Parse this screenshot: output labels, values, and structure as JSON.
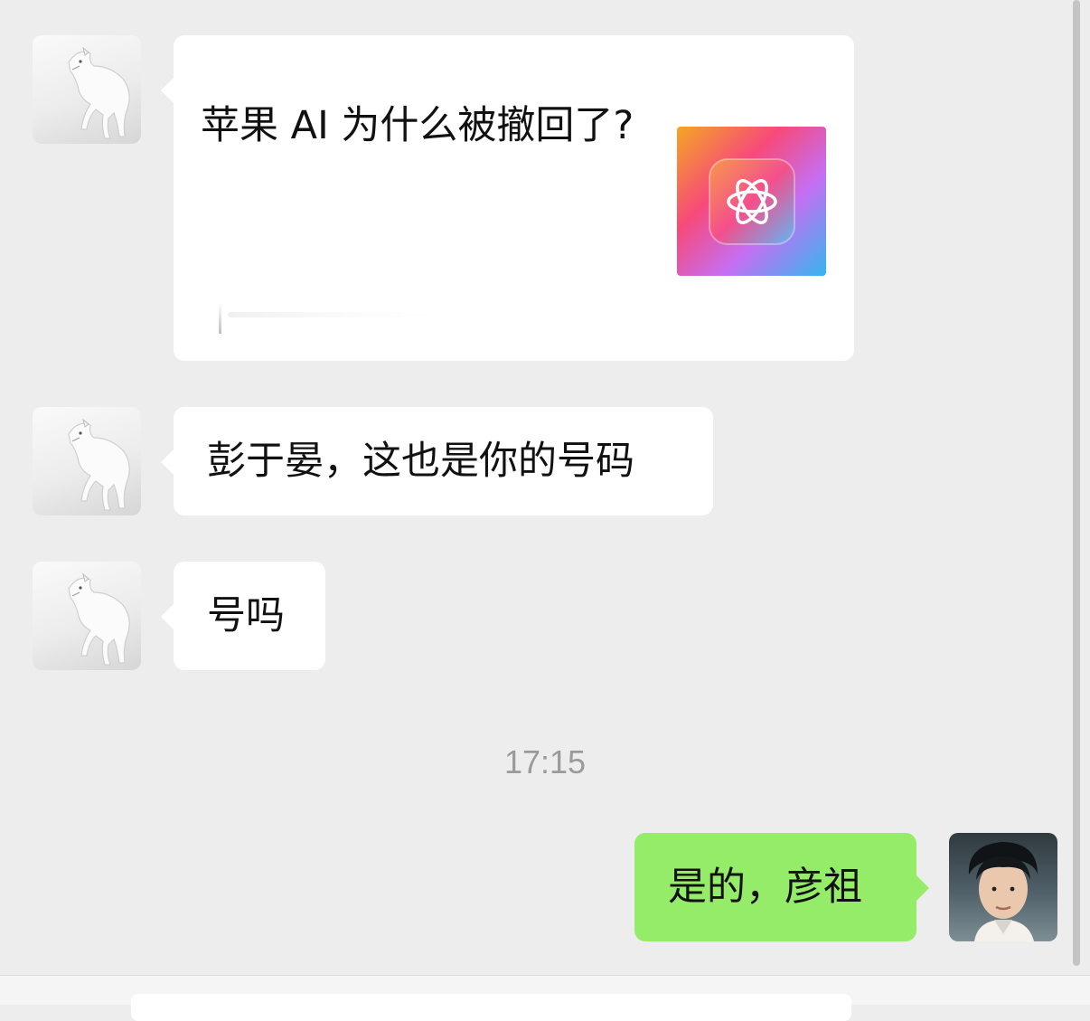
{
  "messages": [
    {
      "type": "link_card",
      "side": "left",
      "title": "苹果 AI 为什么被撤回了?",
      "thumbnail_icon": "apple-intelligence-icon"
    },
    {
      "type": "text",
      "side": "left",
      "text": "彭于晏，这也是你的号码"
    },
    {
      "type": "text",
      "side": "left",
      "text": "号吗"
    },
    {
      "type": "text",
      "side": "right",
      "text": "是的，彦祖"
    }
  ],
  "timestamp": "17:15",
  "colors": {
    "background": "#ededed",
    "incoming_bubble": "#ffffff",
    "outgoing_bubble": "#95ec69",
    "timestamp_text": "#9a9a9a"
  }
}
